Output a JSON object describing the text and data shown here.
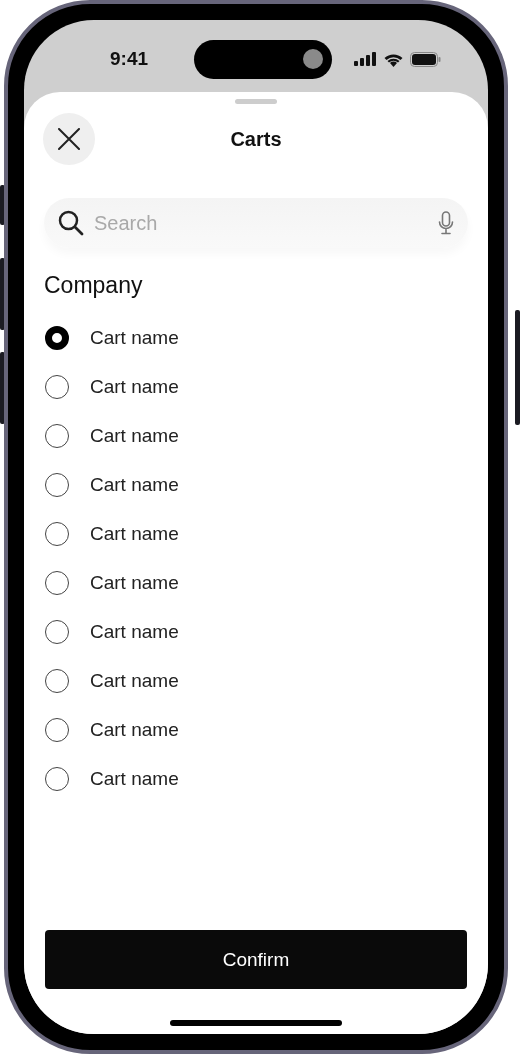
{
  "status_bar": {
    "time": "9:41"
  },
  "sheet": {
    "title": "Carts",
    "search": {
      "placeholder": "Search"
    },
    "section_title": "Company",
    "options": [
      {
        "label": "Cart name",
        "selected": true
      },
      {
        "label": "Cart name",
        "selected": false
      },
      {
        "label": "Cart name",
        "selected": false
      },
      {
        "label": "Cart name",
        "selected": false
      },
      {
        "label": "Cart name",
        "selected": false
      },
      {
        "label": "Cart name",
        "selected": false
      },
      {
        "label": "Cart name",
        "selected": false
      },
      {
        "label": "Cart name",
        "selected": false
      },
      {
        "label": "Cart name",
        "selected": false
      },
      {
        "label": "Cart name",
        "selected": false
      }
    ],
    "confirm_button": "Confirm"
  }
}
